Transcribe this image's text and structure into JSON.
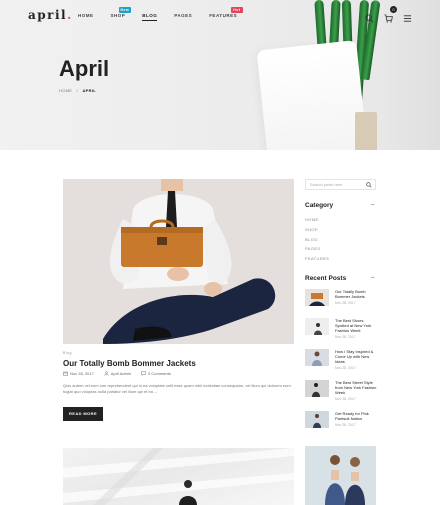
{
  "brand": {
    "name": "april",
    "dot": "."
  },
  "nav": {
    "items": [
      {
        "label": "HOME",
        "badge": ""
      },
      {
        "label": "SHOP",
        "badge": "New"
      },
      {
        "label": "BLOG",
        "badge": ""
      },
      {
        "label": "PAGES",
        "badge": ""
      },
      {
        "label": "FEATURES",
        "badge": "Hot"
      }
    ],
    "cart_count": "0",
    "colors": {
      "new_badge": "#1aa3c9",
      "hot_badge": "#e2455a"
    }
  },
  "hero": {
    "title": "April",
    "breadcrumb": {
      "home": "HOME",
      "separator": "/",
      "current": "APRIL"
    }
  },
  "post": {
    "category": "Blog",
    "title": "Our Totally Bomb Bommer Jackets",
    "date": "Nov 28, 2017",
    "author": "April Admin",
    "comments": "0 Comments",
    "excerpt": "Quis autem vel eum iure reprehenderit qui in ea voluptate velit esse quam nihil molestiae consequatur, vel illum qui dolorem eum fugiat quo voluptas nulla pariatur vel illum qui et ea ...",
    "read_more": "READ MORE"
  },
  "sidebar": {
    "search_placeholder": "Search posts here",
    "category_heading": "Category",
    "categories": [
      "HOME",
      "SHOP",
      "BLOG",
      "PAGES",
      "FEATURES"
    ],
    "recent_heading": "Recent Posts",
    "recent_posts": [
      {
        "title": "Our Totally Bomb Bommer Jackets",
        "date": "Nov 28, 2017"
      },
      {
        "title": "The Best Shoes Spotted at New York Fashion Week",
        "date": "Nov 28, 2017"
      },
      {
        "title": "How I Stay Inspired & Come Up with New Ideas",
        "date": "Nov 28, 2017"
      },
      {
        "title": "The Best Street Style from New York Fashion Week",
        "date": "Nov 28, 2017"
      },
      {
        "title": "Get Ready for Pink Pantsuit Nation",
        "date": "Nov 28, 2017"
      }
    ]
  }
}
